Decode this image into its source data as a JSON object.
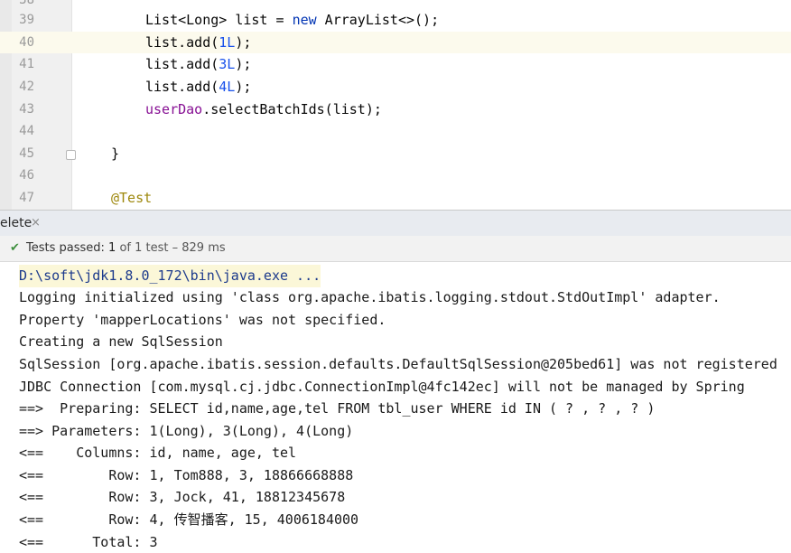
{
  "editor": {
    "lines": [
      {
        "num": "38",
        "text": ""
      },
      {
        "num": "39",
        "text": "List<Long> list = new ArrayList<>();"
      },
      {
        "num": "40",
        "text": "list.add(1L);"
      },
      {
        "num": "41",
        "text": "list.add(3L);"
      },
      {
        "num": "42",
        "text": "list.add(4L);"
      },
      {
        "num": "43",
        "text": "userDao.selectBatchIds(list);"
      },
      {
        "num": "44",
        "text": ""
      },
      {
        "num": "45",
        "text": "}"
      },
      {
        "num": "46",
        "text": ""
      },
      {
        "num": "47",
        "text": "@Test"
      }
    ]
  },
  "run_tab": {
    "label": "elete",
    "close": "×"
  },
  "status": {
    "check_icon": "check-icon",
    "prefix": "Tests passed: ",
    "count": "1",
    "suffix": " of 1 test – 829 ms"
  },
  "console": {
    "lines": [
      "D:\\soft\\jdk1.8.0_172\\bin\\java.exe ...",
      "Logging initialized using 'class org.apache.ibatis.logging.stdout.StdOutImpl' adapter.",
      "Property 'mapperLocations' was not specified.",
      "Creating a new SqlSession",
      "SqlSession [org.apache.ibatis.session.defaults.DefaultSqlSession@205bed61] was not registered",
      "JDBC Connection [com.mysql.cj.jdbc.ConnectionImpl@4fc142ec] will not be managed by Spring",
      "==>  Preparing: SELECT id,name,age,tel FROM tbl_user WHERE id IN ( ? , ? , ? )",
      "==> Parameters: 1(Long), 3(Long), 4(Long)",
      "<==    Columns: id, name, age, tel",
      "<==        Row: 1, Tom888, 3, 18866668888",
      "<==        Row: 3, Jock, 41, 18812345678",
      "<==        Row: 4, 传智播客, 15, 4006184000",
      "<==      Total: 3"
    ]
  }
}
